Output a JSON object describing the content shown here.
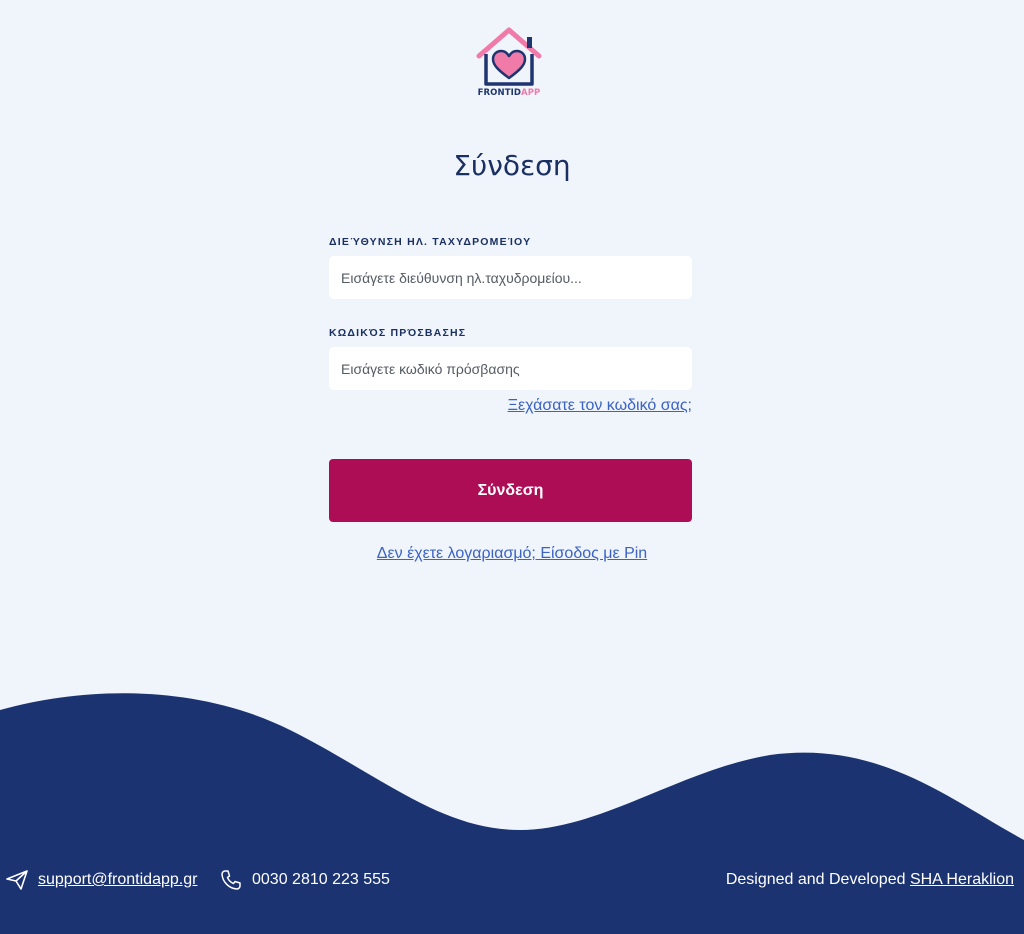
{
  "brand": {
    "name_part1": "FRONTID",
    "name_part2": "APP",
    "logo_icon": "house-heart-icon",
    "colors": {
      "primary_navy": "#1a2f62",
      "accent_pink": "#f07aa8",
      "button_crimson": "#ad0d55",
      "link_blue": "#3b62c4",
      "background": "#f0f5fc"
    }
  },
  "form": {
    "title": "Σύνδεση",
    "email_label": "ΔΙΕΎΘΥΝΣΗ ΗΛ. ΤΑΧΥΔΡΟΜΕΊΟΥ",
    "email_placeholder": "Εισάγετε διεύθυνση ηλ.ταχυδρομείου...",
    "email_value": "",
    "password_label": "ΚΩΔΙΚΌΣ ΠΡΌΣΒΑΣΗΣ",
    "password_placeholder": "Εισάγετε κωδικό πρόσβασης",
    "password_value": "",
    "forgot_link": "Ξεχάσατε τον κωδικό σας;",
    "submit_label": "Σύνδεση",
    "pin_link": "Δεν έχετε λογαριασμό; Είσοδος με Pin"
  },
  "footer": {
    "email_icon": "paper-plane-icon",
    "email": "support@frontidapp.gr",
    "phone_icon": "phone-icon",
    "phone": "0030 2810 223 555",
    "credit_prefix": "Designed and Developed",
    "credit_link": "SHA Heraklion",
    "background": "#1b3370"
  }
}
